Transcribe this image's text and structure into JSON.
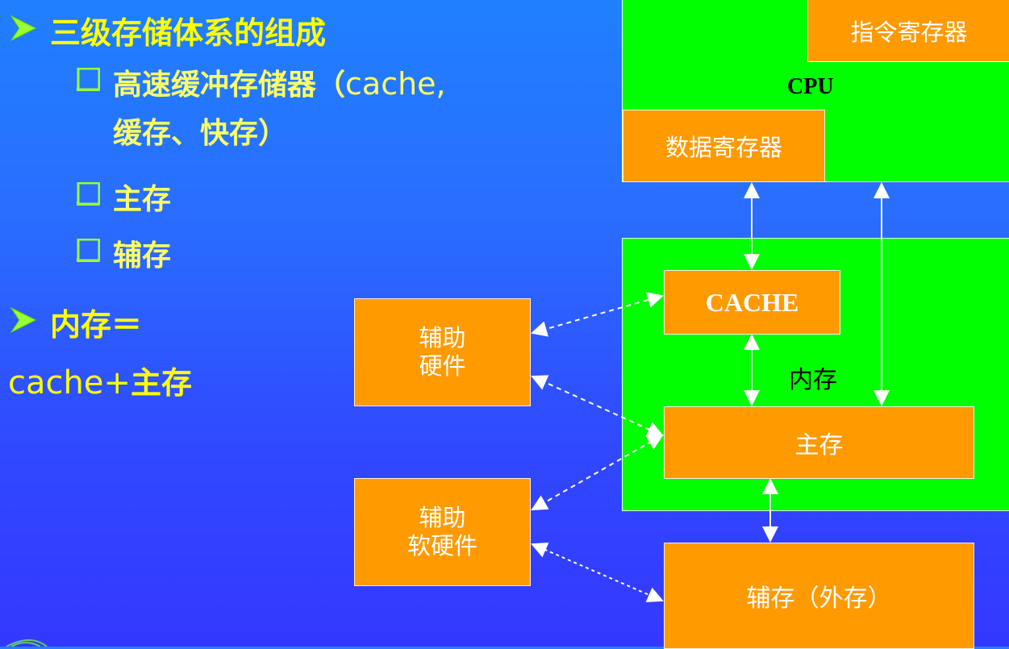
{
  "slide": {
    "bullets": [
      {
        "icon": "arrow-bullet-icon",
        "text": "三级存储体系的组成"
      },
      {
        "icon": "square-bullet-icon",
        "text_cn": "高速缓冲存储器（",
        "text_en": "cache,",
        "text_line2": "缓存、快存）"
      },
      {
        "icon": "square-bullet-icon",
        "text": "主存"
      },
      {
        "icon": "square-bullet-icon",
        "text": "辅存"
      },
      {
        "icon": "arrow-bullet-icon",
        "text": "内存＝"
      }
    ],
    "formula": {
      "en": "cache+",
      "cn": "主存"
    }
  },
  "diagram": {
    "cpu": {
      "label": "CPU",
      "instruction_register": "指令寄存器",
      "data_register": "数据寄存器"
    },
    "memory": {
      "label": "内存",
      "cache": "CACHE",
      "main_memory": "主存"
    },
    "secondary_storage": "辅存（外存）",
    "aux_hardware": {
      "line1": "辅助",
      "line2": "硬件"
    },
    "aux_soft_hardware": {
      "line1": "辅助",
      "line2": "软硬件"
    }
  },
  "colors": {
    "bullet_text": "#ffff00",
    "box_green": "#00ff00",
    "box_orange": "#ff9a00",
    "bullet_icon": "#99ff33"
  }
}
